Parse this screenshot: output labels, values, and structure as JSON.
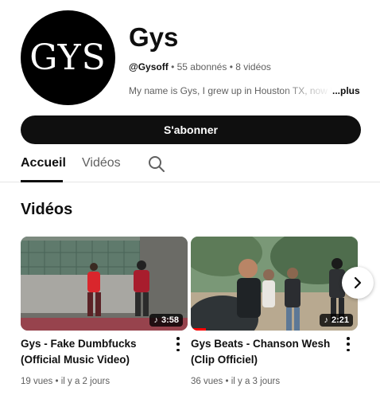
{
  "channel": {
    "avatar_text": "GYS",
    "name": "Gys",
    "handle": "@Gysoff",
    "subscribers": "55 abonnés",
    "videos_count": "8 vidéos",
    "separator": "•",
    "description": "My name is Gys, I grew up in Houston TX, now li",
    "more_label": "...plus"
  },
  "subscribe_label": "S'abonner",
  "tabs": [
    {
      "label": "Accueil",
      "active": true
    },
    {
      "label": "Vidéos",
      "active": false
    }
  ],
  "section": {
    "title": "Vidéos"
  },
  "videos": [
    {
      "title": "Gys - Fake Dumbfucks (Official Music Video)",
      "duration": "3:58",
      "views": "19 vues",
      "age": "il y a 2 jours",
      "progress": 0.0
    },
    {
      "title": "Gys Beats - Chanson Wesh (Clip Officiel)",
      "duration": "2:21",
      "views": "36 vues",
      "age": "il y a 3 jours",
      "progress": 0.09
    }
  ],
  "icons": {
    "search": "search-icon",
    "more": "more-vert-icon",
    "next": "chevron-right-icon",
    "music": "music-note-icon"
  },
  "colors": {
    "accent": "#0f0f0f",
    "secondary_text": "#606060",
    "progress": "#ff0000"
  }
}
